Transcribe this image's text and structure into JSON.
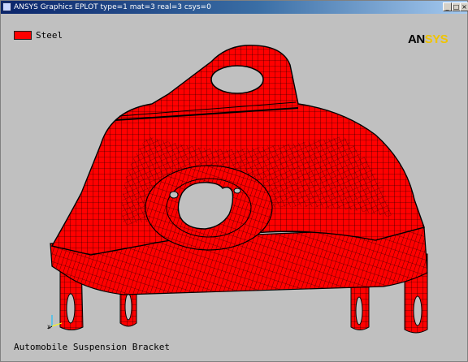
{
  "window": {
    "title": "ANSYS Graphics   EPLOT   type=1 mat=3 real=3 csys=0",
    "controls": {
      "minimize": "_",
      "maximize": "□",
      "close": "×"
    }
  },
  "legend": {
    "material": "Steel",
    "color": "#ff0000"
  },
  "logo": {
    "part1": "AN",
    "part2": "SYS",
    "colors": {
      "part1": "#000000",
      "part2": "#f0c400"
    }
  },
  "caption": "Automobile Suspension Bracket",
  "model": {
    "mesh_color": "#ff0000",
    "edge_color": "#000000"
  }
}
